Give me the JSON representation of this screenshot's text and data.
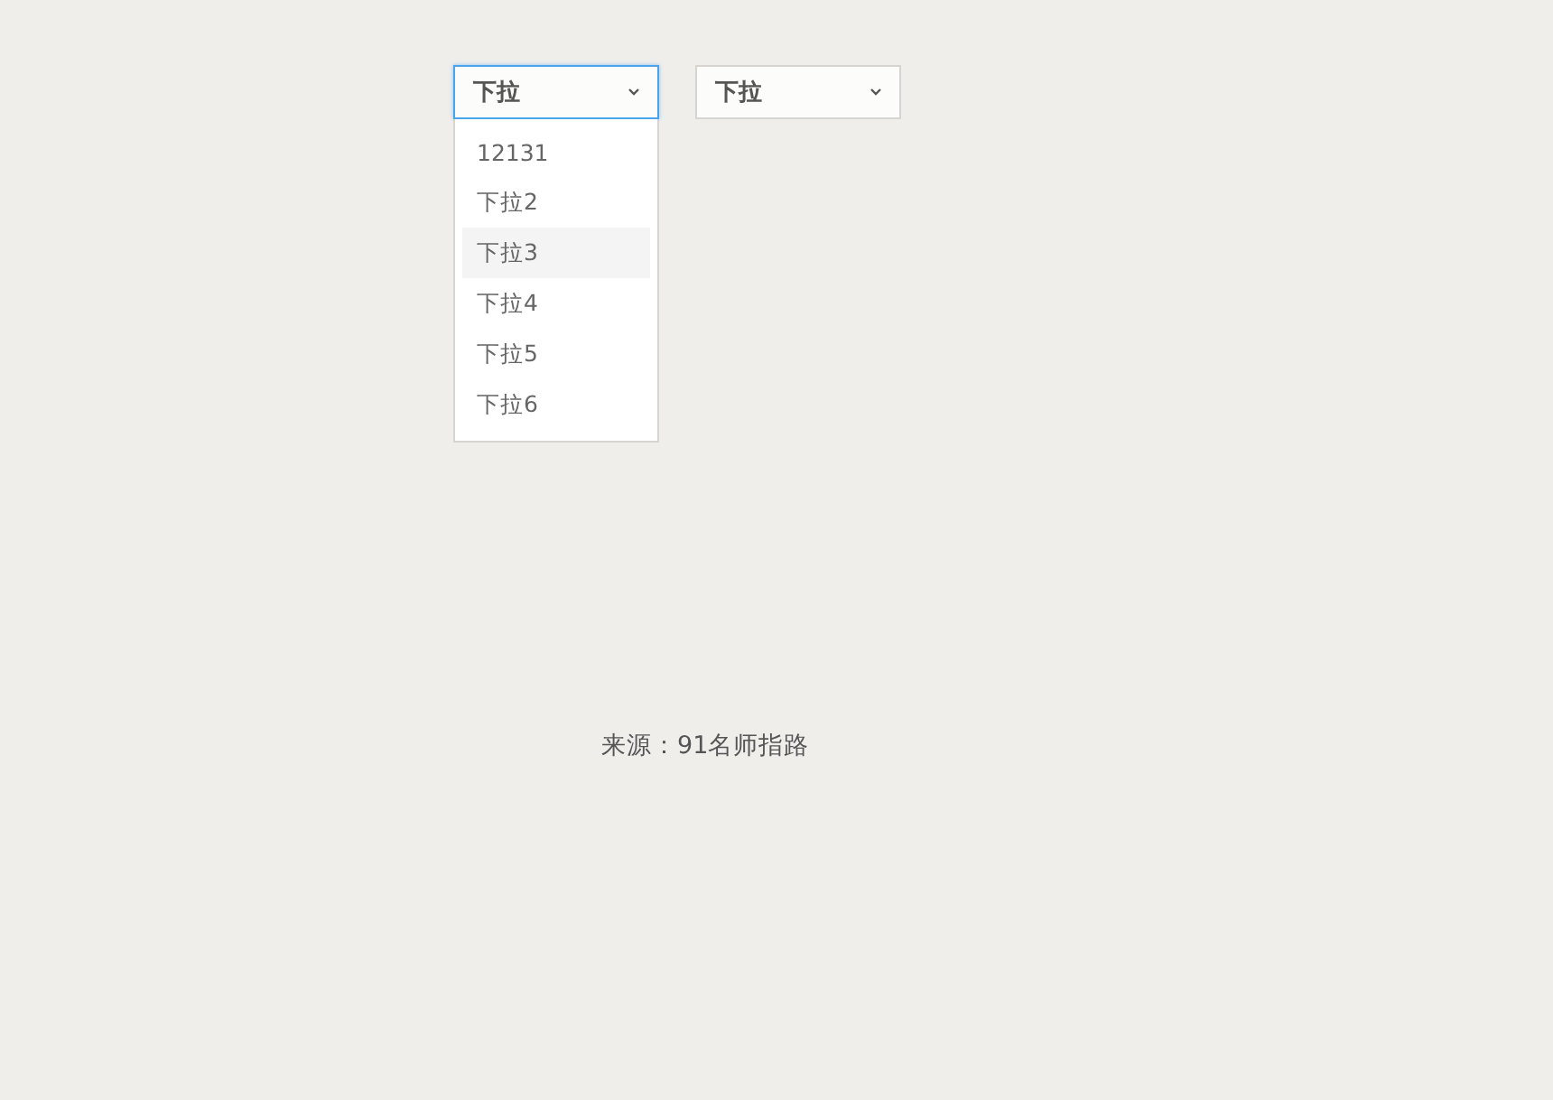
{
  "dropdowns": [
    {
      "value": "下拉",
      "open": true,
      "options": [
        {
          "label": "12131",
          "selected": false
        },
        {
          "label": "下拉2",
          "selected": false
        },
        {
          "label": "下拉3",
          "selected": true
        },
        {
          "label": "下拉4",
          "selected": false
        },
        {
          "label": "下拉5",
          "selected": false
        },
        {
          "label": "下拉6",
          "selected": false
        }
      ]
    },
    {
      "value": "下拉",
      "open": false
    }
  ],
  "footer": "来源：91名师指路"
}
